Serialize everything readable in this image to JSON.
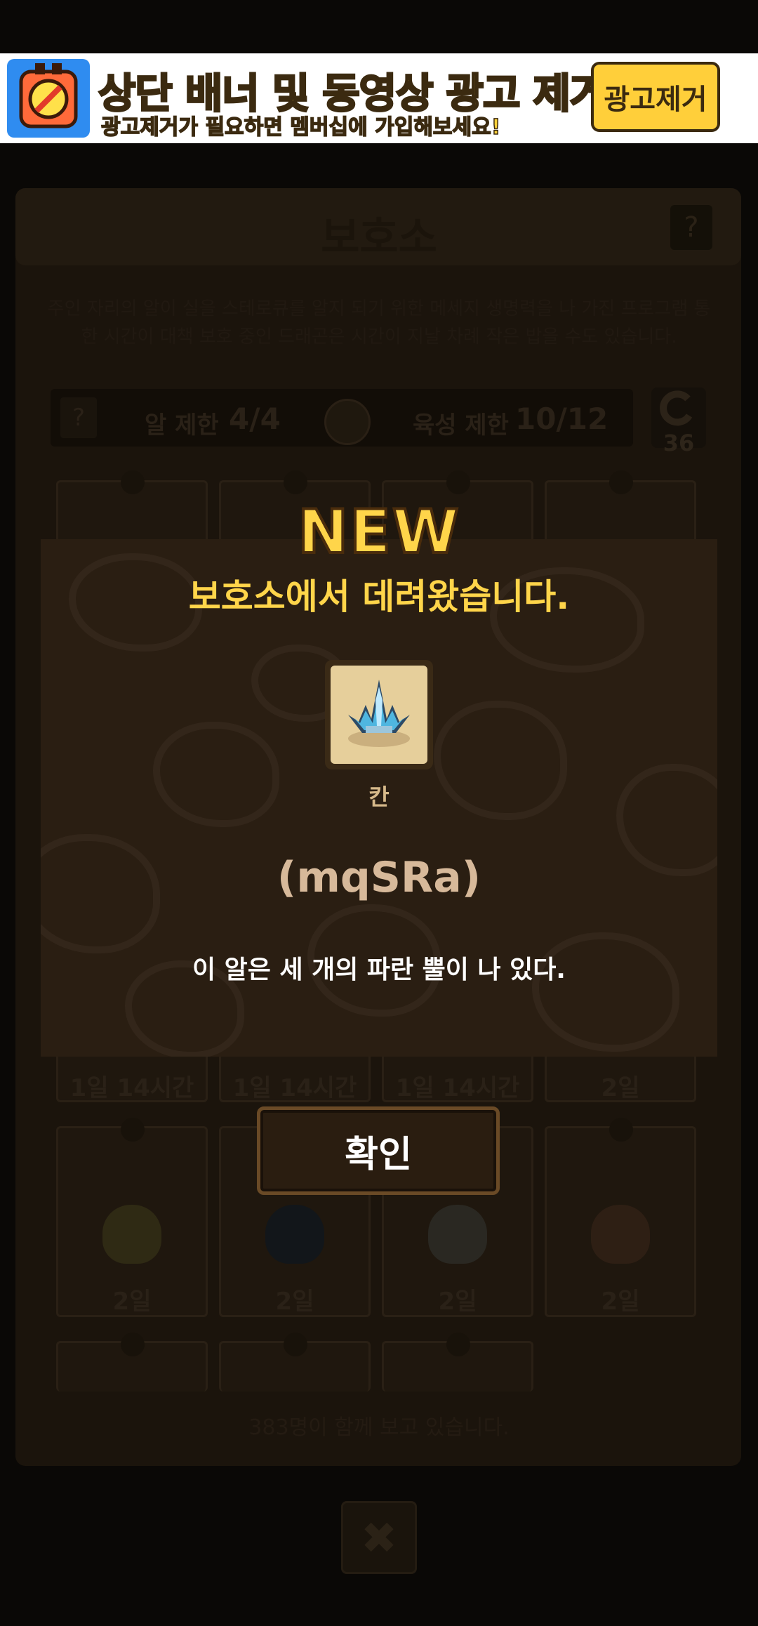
{
  "banner": {
    "title": "상단 배너 및 동영상 광고 제거!",
    "subtitle": "광고제거가 필요하면 멤버십에 가입해보세요!",
    "button_label": "광고제거"
  },
  "background": {
    "title": "보호소",
    "help": "?",
    "description": "주인 자리의 알이 실을 스테로큐를 알지 되기 위한 메세지 생명력을 나 가진 프로그램 통한 시간이 대책 보호 중인 드래곤은 시간이 지날 차례 작은 밥을 수도 있습니다.",
    "limit_help": "?",
    "egg_limit_label": "알 제한",
    "egg_limit_value": "4/4",
    "raise_limit_label": "육성 제한",
    "raise_limit_value": "10/12",
    "refresh_count": "36",
    "row1_labels": [
      "1일 14시간",
      "1일 14시간",
      "1일 14시간",
      "2일"
    ],
    "row2_labels": [
      "2일",
      "2일",
      "2일",
      "2일"
    ],
    "footer": "383명이 함께 보고 있습니다.",
    "close_label": "✖"
  },
  "modal": {
    "new_label": "NEW",
    "title": "보호소에서 데려왔습니다.",
    "egg_name": "칸",
    "egg_code": "(mqSRa)",
    "egg_description": "이 알은 세 개의 파란 뿔이 나 있다.",
    "confirm_label": "확인"
  }
}
